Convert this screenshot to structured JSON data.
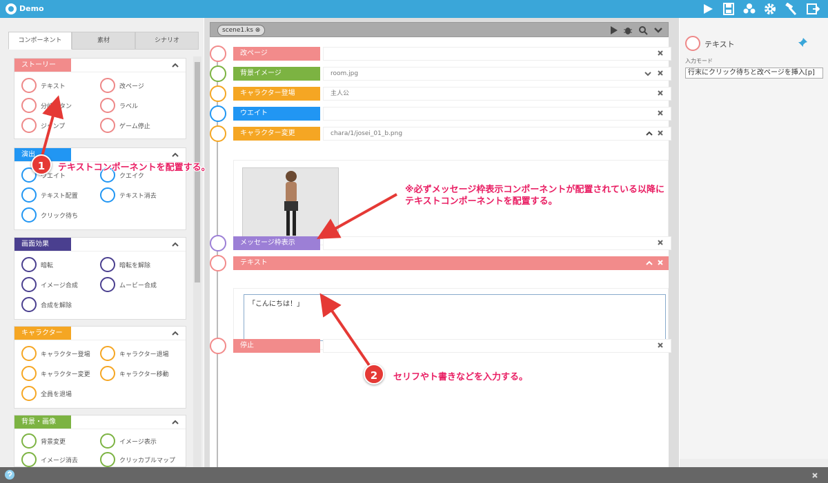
{
  "app": {
    "title": "Demo"
  },
  "left_tabs": [
    "コンポーネント",
    "素材",
    "シナリオ"
  ],
  "panels": [
    {
      "label": "ストーリー",
      "color": "#f28b8b",
      "items": [
        "テキスト",
        "改ページ",
        "分岐ボタン",
        "ラベル",
        "ジャンプ",
        "ゲーム停止"
      ]
    },
    {
      "label": "演出",
      "color": "#2196f3",
      "items": [
        "ウエイト",
        "クエイク",
        "テキスト配置",
        "テキスト消去",
        "クリック待ち"
      ]
    },
    {
      "label": "画面効果",
      "color": "#4a3f8f",
      "items": [
        "暗転",
        "暗転を解除",
        "イメージ合成",
        "ムービー合成",
        "合成を解除"
      ]
    },
    {
      "label": "キャラクター",
      "color": "#f5a623",
      "items": [
        "キャラクター登場",
        "キャラクター退場",
        "キャラクター変更",
        "キャラクター移動",
        "全員を退場"
      ]
    },
    {
      "label": "背景・画像",
      "color": "#7cb342",
      "items": [
        "背景変更",
        "イメージ表示",
        "イメージ消去",
        "クリッカブルマップ"
      ]
    }
  ],
  "scene": {
    "file_tab": "scene1.ks",
    "rows": [
      {
        "label": "改ページ",
        "value": "",
        "color": "#f28b8b"
      },
      {
        "label": "背景イメージ",
        "value": "room.jpg",
        "color": "#7cb342"
      },
      {
        "label": "キャラクター登場",
        "value": "主人公",
        "color": "#f5a623"
      },
      {
        "label": "ウエイト",
        "value": "",
        "color": "#2196f3"
      },
      {
        "label": "キャラクター変更",
        "value": "chara/1/josei_01_b.png",
        "color": "#f5a623"
      },
      {
        "label": "メッセージ枠表示",
        "value": "",
        "color": "#9c7fd6"
      },
      {
        "label": "テキスト",
        "value": "",
        "color": "#f28b8b"
      },
      {
        "label": "停止",
        "value": "",
        "color": "#f28b8b"
      }
    ],
    "text_content": "「こんにちは！」"
  },
  "right": {
    "title": "テキスト",
    "input_mode_label": "入力モード",
    "input_mode_value": "行末にクリック待ちと改ページを挿入[p]"
  },
  "annotations": {
    "one_number": "1",
    "one_text": "テキストコンポーネントを配置する。",
    "note_line1": "※必ずメッセージ枠表示コンポーネントが配置されている以降に",
    "note_line2": "テキストコンポーネントを配置する。",
    "two_number": "2",
    "two_text": "セリフやト書きなどを入力する。"
  },
  "colors": {
    "accent": "#3aa6d9",
    "annotation": "#e91e63"
  },
  "icons": [
    "play-icon",
    "save-icon",
    "users-icon",
    "gear-icon",
    "hammer-icon",
    "export-icon",
    "bug-icon",
    "search-icon",
    "chevron-down-icon",
    "pin-icon",
    "close-icon",
    "help-icon"
  ]
}
